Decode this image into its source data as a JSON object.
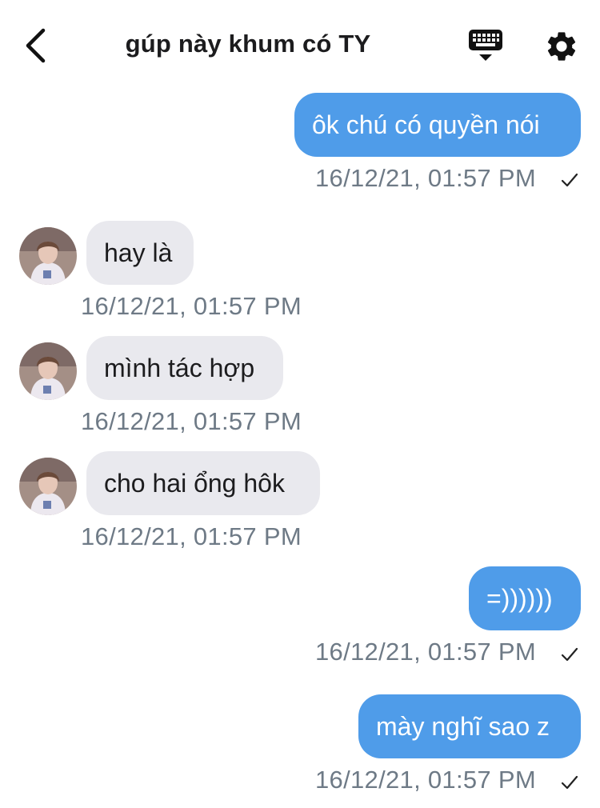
{
  "header": {
    "title": "gúp này khum có TY",
    "back_icon": "chevron-left-icon",
    "keyboard_icon": "keyboard-icon",
    "settings_icon": "gear-icon"
  },
  "colors": {
    "outgoing_bubble": "#4f9ce9",
    "incoming_bubble": "#e9e9ee",
    "timestamp": "#6e7a86"
  },
  "messages": [
    {
      "direction": "outgoing",
      "text": "ôk chú có quyền nói",
      "time": "16/12/21, 01:57 PM",
      "status": "sent-check"
    },
    {
      "direction": "incoming",
      "text": "hay là",
      "time": "16/12/21, 01:57 PM"
    },
    {
      "direction": "incoming",
      "text": "mình tác hợp",
      "time": "16/12/21, 01:57 PM"
    },
    {
      "direction": "incoming",
      "text": "cho hai ổng hôk",
      "time": "16/12/21, 01:57 PM"
    },
    {
      "direction": "outgoing",
      "text": "=))))))",
      "time": "16/12/21, 01:57 PM",
      "status": "sent-check"
    },
    {
      "direction": "outgoing",
      "text": "mày nghĩ sao z",
      "time": "16/12/21, 01:57 PM",
      "status": "sent-check"
    }
  ]
}
